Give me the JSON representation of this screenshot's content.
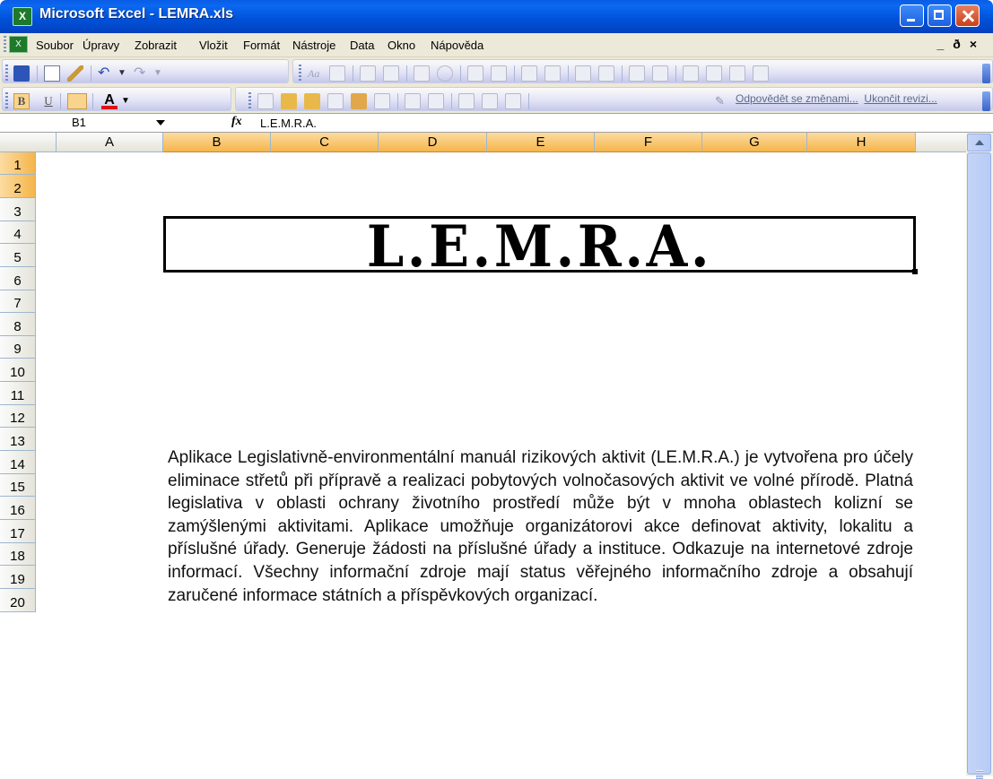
{
  "window": {
    "title": "Microsoft Excel - LEMRA.xls",
    "app_icon": "excel-icon"
  },
  "menu": {
    "items": [
      "Soubor",
      "Úpravy",
      "Zobrazit",
      "Vložit",
      "Formát",
      "Nástroje",
      "Data",
      "Okno",
      "Nápověda"
    ],
    "controls": "_ ð ×"
  },
  "toolbar": {
    "review_accept_label": "Odpovědět se změnami...",
    "review_end_label": "Ukončit revizi..."
  },
  "formula_bar": {
    "name_box": "B1",
    "fx": "fx",
    "value": "L.E.M.R.A."
  },
  "columns": [
    "A",
    "B",
    "C",
    "D",
    "E",
    "F",
    "G",
    "H"
  ],
  "rows": [
    "1",
    "2",
    "3",
    "4",
    "5",
    "6",
    "7",
    "8",
    "9",
    "10",
    "11",
    "12",
    "13",
    "14",
    "15",
    "16",
    "17",
    "18",
    "19",
    "20"
  ],
  "sheet": {
    "title": "L.E.M.R.A.",
    "description": "Aplikace Legislativně-environmentální manuál rizikových aktivit (LE.M.R.A.) je vytvořena pro účely eliminace střetů při přípravě a realizaci pobytových volnočasových aktivit ve volné přírodě. Platná legislativa v oblasti ochrany životního prostředí může být v mnoha oblastech kolizní se zamýšlenými aktivitami. Aplikace umožňuje organizátorovi akce definovat aktivity, lokalitu a příslušné úřady. Generuje žádosti na příslušné úřady a instituce. Odkazuje na internetové zdroje informací. Všechny informační zdroje mají status věřejného informačního zdroje a obsahují zaručené informace státních a příspěvkových organizací."
  }
}
